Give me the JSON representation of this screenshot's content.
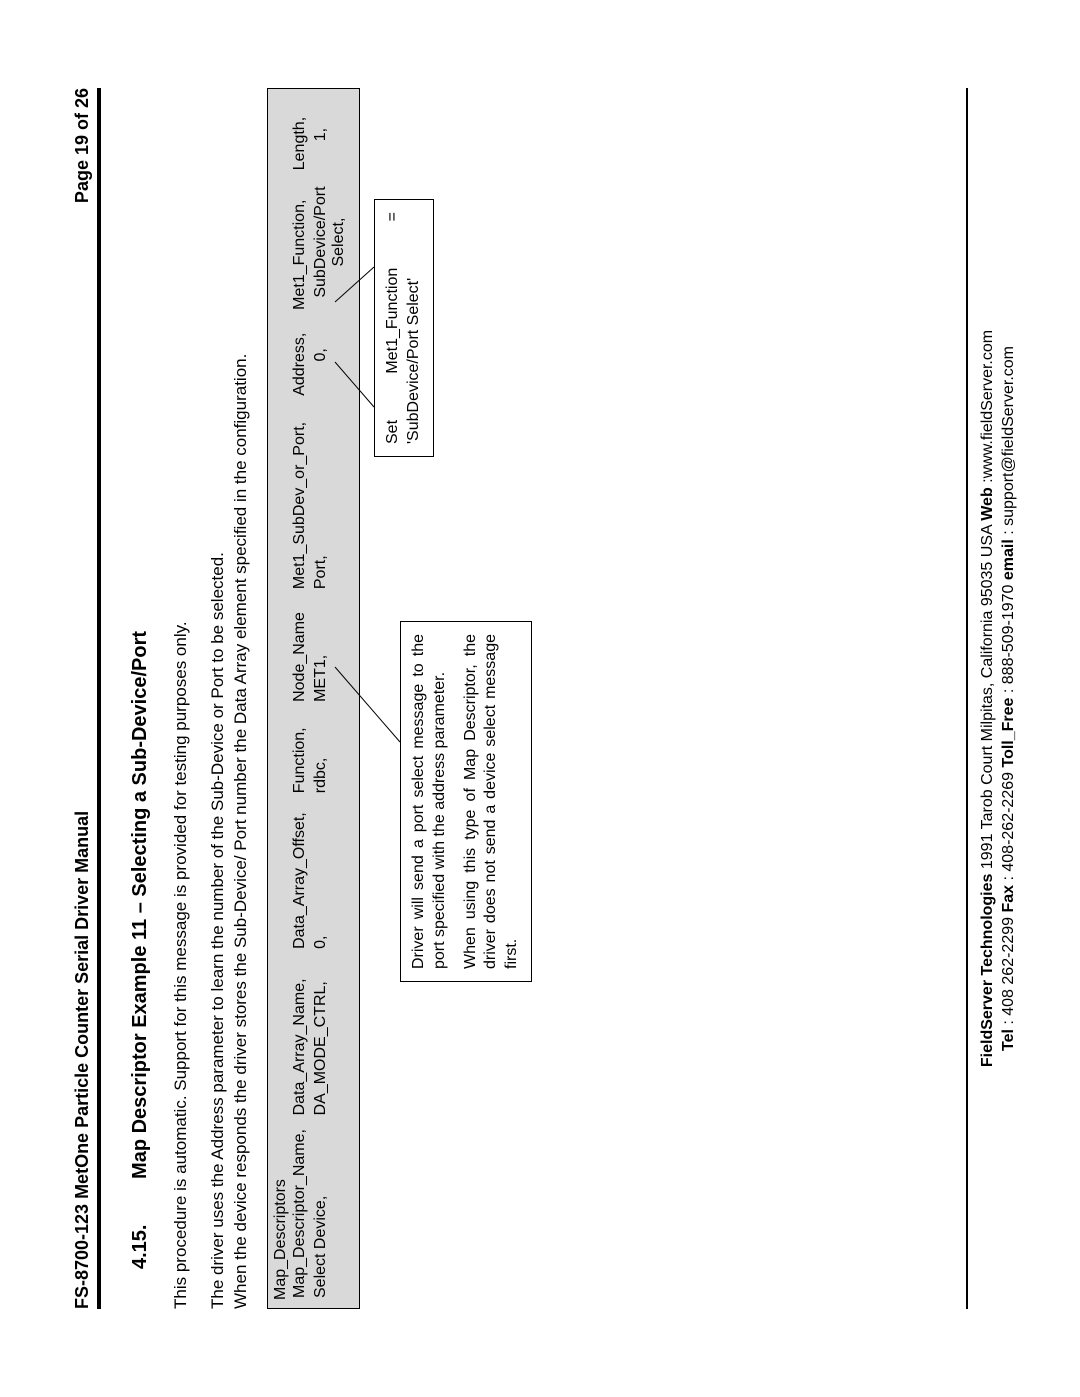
{
  "header": {
    "doc_title": "FS-8700-123 MetOne Particle Counter Serial Driver Manual",
    "page_label": "Page 19 of 26"
  },
  "section": {
    "number": "4.15.",
    "title": "Map Descriptor Example 11 – Selecting a Sub-Device/Port"
  },
  "paragraphs": {
    "p1": "This procedure is automatic.  Support for this message is provided for testing purposes only.",
    "p2": "The driver uses the Address parameter to learn the number of the Sub-Device or Port to be selected.",
    "p3": "When the device responds the driver stores the Sub-Device/ Port number the Data Array element specified in the configuration."
  },
  "table": {
    "title": "Map_Descriptors",
    "headers": {
      "c0": "Map_Descriptor_Name,",
      "c1": "Data_Array_Name,",
      "c2": "Data_Array_Offset,",
      "c3": "Function,",
      "c4": "Node_Name",
      "c5": "Met1_SubDev_or_Port,",
      "c6": "Address,",
      "c7": "Met1_Function,",
      "c8": "Length,"
    },
    "row": {
      "c0": "Select Device,",
      "c1": "DA_MODE_CTRL,",
      "c2": "0,",
      "c3": "rdbc,",
      "c4": "MET1,",
      "c5": "Port,",
      "c6": "0,",
      "c7_line1": "SubDevice/Port",
      "c7_line2": "Select,",
      "c8": "1,"
    }
  },
  "callouts": {
    "left": {
      "p1": "Driver will send a port select message to the port specified with the address parameter.",
      "p2": "When using this type of Map Descriptor, the driver does not send a device select message first."
    },
    "right": {
      "text": "Set Met1_Function = 'SubDevice/Port Select'"
    }
  },
  "footer": {
    "line1_company": "FieldServer Technologies",
    "line1_rest": " 1991 Tarob Court Milpitas, California 95035 USA ",
    "line1_web_lbl": "Web",
    "line1_web_val": ":www.fieldServer.com",
    "line2_tel_lbl": "Tel",
    "line2_tel_val": ": 408 262-2299   ",
    "line2_fax_lbl": "Fax",
    "line2_fax_val": ": 408-262-2269   ",
    "line2_tf_lbl": "Toll_Free",
    "line2_tf_val": ": 888-509-1970   ",
    "line2_em_lbl": "email",
    "line2_em_val": ": support@fieldServer.com"
  }
}
